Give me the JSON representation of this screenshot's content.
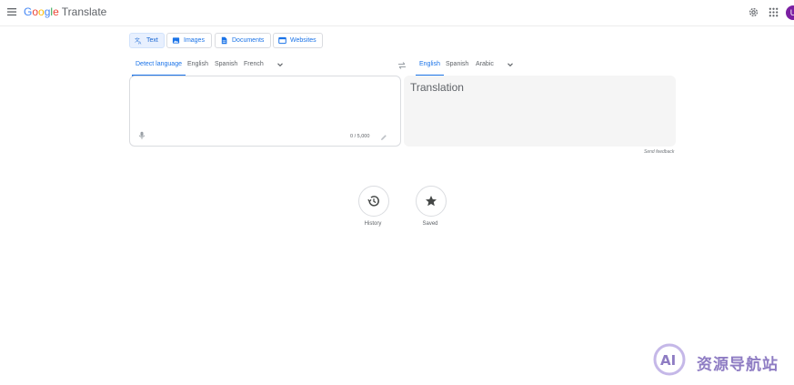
{
  "header": {
    "logo_letters": [
      "G",
      "o",
      "o",
      "g",
      "l",
      "e"
    ],
    "product": "Translate",
    "avatar_initial": "U",
    "brand_colors": [
      "#4285f4",
      "#ea4335",
      "#fbbc05",
      "#34a853"
    ],
    "avatar_color": "#7b1fa2",
    "icons": [
      "menu-icon",
      "settings-icon",
      "apps-icon"
    ]
  },
  "modes": [
    {
      "label": "Text",
      "icon": "translate-icon",
      "active": true
    },
    {
      "label": "Images",
      "icon": "image-icon",
      "active": false
    },
    {
      "label": "Documents",
      "icon": "document-icon",
      "active": false
    },
    {
      "label": "Websites",
      "icon": "website-icon",
      "active": false
    }
  ],
  "source": {
    "languages": [
      "Detect language",
      "English",
      "Spanish",
      "French"
    ],
    "selected": "Detect language",
    "text": "",
    "char_count": "0 / 5,000"
  },
  "target": {
    "languages": [
      "English",
      "Spanish",
      "Arabic"
    ],
    "selected": "English",
    "placeholder": "Translation"
  },
  "feedback_label": "Send feedback",
  "shortcuts": [
    {
      "label": "History",
      "icon": "history-icon"
    },
    {
      "label": "Saved",
      "icon": "star-icon"
    }
  ],
  "watermark": {
    "badge": "AI",
    "text": "资源导航站"
  },
  "accent_color": "#1a73e8"
}
